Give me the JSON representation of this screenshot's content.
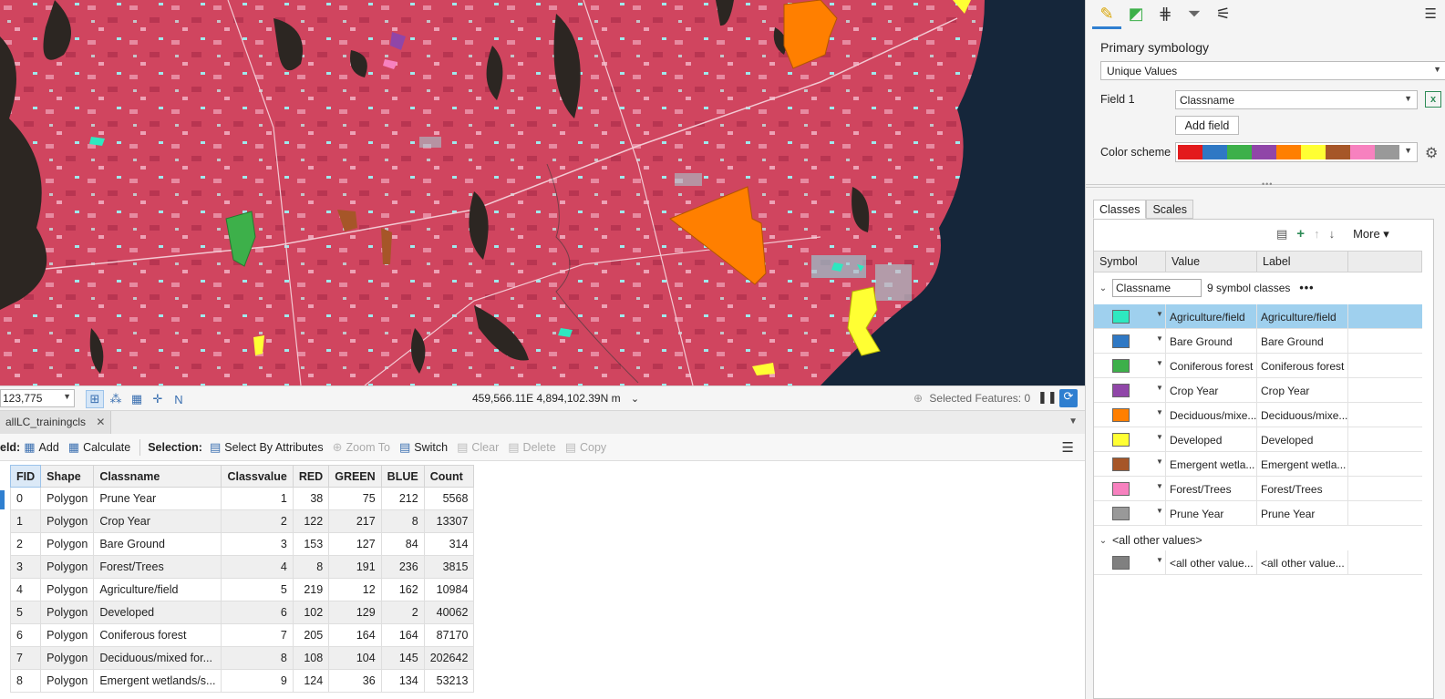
{
  "map_status": {
    "scale": "123,775",
    "coordinates": "459,566.11E 4,894,102.39N m",
    "selected_features": "Selected Features: 0"
  },
  "table": {
    "tab_title": "allLC_trainingcls",
    "toolbar": {
      "field_label": "eld:",
      "add": "Add",
      "calculate": "Calculate",
      "selection_label": "Selection:",
      "select_by_attributes": "Select By Attributes",
      "zoom_to": "Zoom To",
      "switch": "Switch",
      "clear": "Clear",
      "delete": "Delete",
      "copy": "Copy"
    },
    "columns": [
      "FID",
      "Shape",
      "Classname",
      "Classvalue",
      "RED",
      "GREEN",
      "BLUE",
      "Count"
    ],
    "rows": [
      [
        "0",
        "Polygon",
        "Prune Year",
        "1",
        "38",
        "75",
        "212",
        "5568"
      ],
      [
        "1",
        "Polygon",
        "Crop Year",
        "2",
        "122",
        "217",
        "8",
        "13307"
      ],
      [
        "2",
        "Polygon",
        "Bare Ground",
        "3",
        "153",
        "127",
        "84",
        "314"
      ],
      [
        "3",
        "Polygon",
        "Forest/Trees",
        "4",
        "8",
        "191",
        "236",
        "3815"
      ],
      [
        "4",
        "Polygon",
        "Agriculture/field",
        "5",
        "219",
        "12",
        "162",
        "10984"
      ],
      [
        "5",
        "Polygon",
        "Developed",
        "6",
        "102",
        "129",
        "2",
        "40062"
      ],
      [
        "6",
        "Polygon",
        "Coniferous forest",
        "7",
        "205",
        "164",
        "164",
        "87170"
      ],
      [
        "7",
        "Polygon",
        "Deciduous/mixed for...",
        "8",
        "108",
        "104",
        "145",
        "202642"
      ],
      [
        "8",
        "Polygon",
        "Emergent wetlands/s...",
        "9",
        "124",
        "36",
        "134",
        "53213"
      ]
    ]
  },
  "symbology": {
    "primary_title": "Primary symbology",
    "primary_value": "Unique Values",
    "field1_label": "Field 1",
    "field1_value": "Classname",
    "add_field": "Add field",
    "color_scheme_label": "Color scheme",
    "color_scheme": [
      "#e31a1c",
      "#2f78c4",
      "#3db04a",
      "#9046a8",
      "#ff7f00",
      "#ffff33",
      "#a65628",
      "#f781bf",
      "#999999"
    ],
    "tabs": [
      "Classes",
      "Scales"
    ],
    "more_label": "More",
    "headers": [
      "Symbol",
      "Value",
      "Label"
    ],
    "group_field": "Classname",
    "group_count": "9 symbol classes",
    "classes": [
      {
        "value": "Agriculture/field",
        "label": "Agriculture/field",
        "color": "#2ee8c0"
      },
      {
        "value": "Bare Ground",
        "label": "Bare Ground",
        "color": "#2f78c4"
      },
      {
        "value": "Coniferous forest",
        "label": "Coniferous forest",
        "color": "#3db04a"
      },
      {
        "value": "Crop Year",
        "label": "Crop Year",
        "color": "#9046a8"
      },
      {
        "value": "Deciduous/mixe...",
        "label": "Deciduous/mixe...",
        "color": "#ff7f00"
      },
      {
        "value": "Developed",
        "label": "Developed",
        "color": "#ffff33"
      },
      {
        "value": "Emergent wetla...",
        "label": "Emergent wetla...",
        "color": "#a65628"
      },
      {
        "value": "Forest/Trees",
        "label": "Forest/Trees",
        "color": "#f781bf"
      },
      {
        "value": "Prune Year",
        "label": "Prune Year",
        "color": "#999999"
      }
    ],
    "other_group": "<all other values>",
    "other_row": {
      "value": "<all other value...",
      "label": "<all other value...",
      "color": "#808080"
    }
  }
}
